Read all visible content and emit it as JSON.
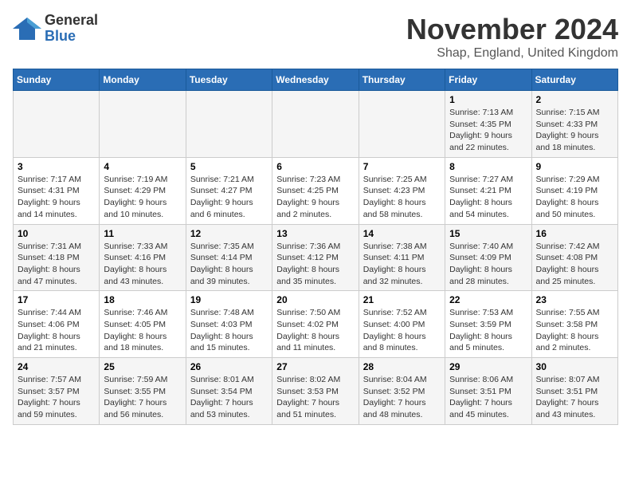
{
  "logo": {
    "general": "General",
    "blue": "Blue"
  },
  "header": {
    "month": "November 2024",
    "location": "Shap, England, United Kingdom"
  },
  "days_of_week": [
    "Sunday",
    "Monday",
    "Tuesday",
    "Wednesday",
    "Thursday",
    "Friday",
    "Saturday"
  ],
  "weeks": [
    [
      {
        "day": "",
        "info": ""
      },
      {
        "day": "",
        "info": ""
      },
      {
        "day": "",
        "info": ""
      },
      {
        "day": "",
        "info": ""
      },
      {
        "day": "",
        "info": ""
      },
      {
        "day": "1",
        "info": "Sunrise: 7:13 AM\nSunset: 4:35 PM\nDaylight: 9 hours and 22 minutes."
      },
      {
        "day": "2",
        "info": "Sunrise: 7:15 AM\nSunset: 4:33 PM\nDaylight: 9 hours and 18 minutes."
      }
    ],
    [
      {
        "day": "3",
        "info": "Sunrise: 7:17 AM\nSunset: 4:31 PM\nDaylight: 9 hours and 14 minutes."
      },
      {
        "day": "4",
        "info": "Sunrise: 7:19 AM\nSunset: 4:29 PM\nDaylight: 9 hours and 10 minutes."
      },
      {
        "day": "5",
        "info": "Sunrise: 7:21 AM\nSunset: 4:27 PM\nDaylight: 9 hours and 6 minutes."
      },
      {
        "day": "6",
        "info": "Sunrise: 7:23 AM\nSunset: 4:25 PM\nDaylight: 9 hours and 2 minutes."
      },
      {
        "day": "7",
        "info": "Sunrise: 7:25 AM\nSunset: 4:23 PM\nDaylight: 8 hours and 58 minutes."
      },
      {
        "day": "8",
        "info": "Sunrise: 7:27 AM\nSunset: 4:21 PM\nDaylight: 8 hours and 54 minutes."
      },
      {
        "day": "9",
        "info": "Sunrise: 7:29 AM\nSunset: 4:19 PM\nDaylight: 8 hours and 50 minutes."
      }
    ],
    [
      {
        "day": "10",
        "info": "Sunrise: 7:31 AM\nSunset: 4:18 PM\nDaylight: 8 hours and 47 minutes."
      },
      {
        "day": "11",
        "info": "Sunrise: 7:33 AM\nSunset: 4:16 PM\nDaylight: 8 hours and 43 minutes."
      },
      {
        "day": "12",
        "info": "Sunrise: 7:35 AM\nSunset: 4:14 PM\nDaylight: 8 hours and 39 minutes."
      },
      {
        "day": "13",
        "info": "Sunrise: 7:36 AM\nSunset: 4:12 PM\nDaylight: 8 hours and 35 minutes."
      },
      {
        "day": "14",
        "info": "Sunrise: 7:38 AM\nSunset: 4:11 PM\nDaylight: 8 hours and 32 minutes."
      },
      {
        "day": "15",
        "info": "Sunrise: 7:40 AM\nSunset: 4:09 PM\nDaylight: 8 hours and 28 minutes."
      },
      {
        "day": "16",
        "info": "Sunrise: 7:42 AM\nSunset: 4:08 PM\nDaylight: 8 hours and 25 minutes."
      }
    ],
    [
      {
        "day": "17",
        "info": "Sunrise: 7:44 AM\nSunset: 4:06 PM\nDaylight: 8 hours and 21 minutes."
      },
      {
        "day": "18",
        "info": "Sunrise: 7:46 AM\nSunset: 4:05 PM\nDaylight: 8 hours and 18 minutes."
      },
      {
        "day": "19",
        "info": "Sunrise: 7:48 AM\nSunset: 4:03 PM\nDaylight: 8 hours and 15 minutes."
      },
      {
        "day": "20",
        "info": "Sunrise: 7:50 AM\nSunset: 4:02 PM\nDaylight: 8 hours and 11 minutes."
      },
      {
        "day": "21",
        "info": "Sunrise: 7:52 AM\nSunset: 4:00 PM\nDaylight: 8 hours and 8 minutes."
      },
      {
        "day": "22",
        "info": "Sunrise: 7:53 AM\nSunset: 3:59 PM\nDaylight: 8 hours and 5 minutes."
      },
      {
        "day": "23",
        "info": "Sunrise: 7:55 AM\nSunset: 3:58 PM\nDaylight: 8 hours and 2 minutes."
      }
    ],
    [
      {
        "day": "24",
        "info": "Sunrise: 7:57 AM\nSunset: 3:57 PM\nDaylight: 7 hours and 59 minutes."
      },
      {
        "day": "25",
        "info": "Sunrise: 7:59 AM\nSunset: 3:55 PM\nDaylight: 7 hours and 56 minutes."
      },
      {
        "day": "26",
        "info": "Sunrise: 8:01 AM\nSunset: 3:54 PM\nDaylight: 7 hours and 53 minutes."
      },
      {
        "day": "27",
        "info": "Sunrise: 8:02 AM\nSunset: 3:53 PM\nDaylight: 7 hours and 51 minutes."
      },
      {
        "day": "28",
        "info": "Sunrise: 8:04 AM\nSunset: 3:52 PM\nDaylight: 7 hours and 48 minutes."
      },
      {
        "day": "29",
        "info": "Sunrise: 8:06 AM\nSunset: 3:51 PM\nDaylight: 7 hours and 45 minutes."
      },
      {
        "day": "30",
        "info": "Sunrise: 8:07 AM\nSunset: 3:51 PM\nDaylight: 7 hours and 43 minutes."
      }
    ]
  ]
}
